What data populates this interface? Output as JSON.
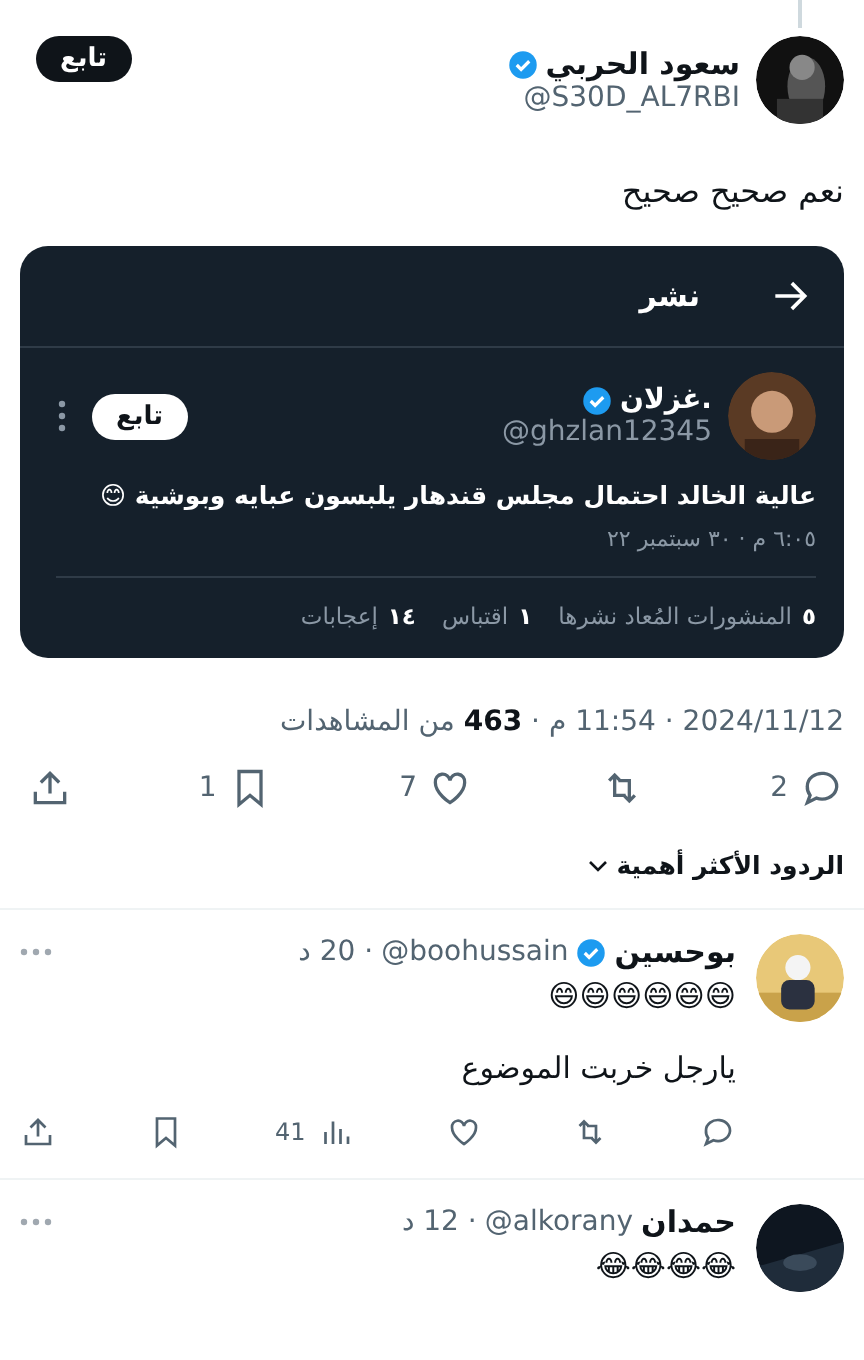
{
  "post": {
    "author": {
      "name": "سعود الحربي",
      "handle": "@S30D_AL7RBI",
      "verified": true
    },
    "follow_button": "تابع",
    "text": "نعم صحيح صحيح"
  },
  "quoted_card": {
    "title": "نشر",
    "author": {
      "name": ".غزلان",
      "handle": "@ghzlan12345",
      "verified": true
    },
    "follow_button": "تابع",
    "text": "عالية الخالد احتمال مجلس قندهار يلبسون عبايه وبوشية 😊",
    "timestamp": "٦:٠٥ م · ٣٠ سبتمبر ٢٢",
    "stats": [
      {
        "count": "٥",
        "label": "المنشورات المُعاد نشرها"
      },
      {
        "count": "١",
        "label": "اقتباس"
      },
      {
        "count": "١٤",
        "label": "إعجابات"
      }
    ]
  },
  "meta": "2024/11/12 · 11:54 م · **463** من المشاهدات",
  "actions": [
    {
      "kind": "reply",
      "count": "2"
    },
    {
      "kind": "repost"
    },
    {
      "kind": "like",
      "count": "7"
    },
    {
      "kind": "bookmark",
      "count": "1"
    },
    {
      "kind": "share"
    }
  ],
  "sort_label": "الردود الأكثر أهمية",
  "replies": [
    {
      "name": "بوحسين",
      "verified": true,
      "handle": "@boohussain",
      "time": "· 20 د",
      "lines": [
        "😄😄😄😄😄😄",
        "يارجل خربت الموضوع"
      ],
      "actions": [
        {
          "kind": "reply"
        },
        {
          "kind": "repost"
        },
        {
          "kind": "like"
        },
        {
          "kind": "views",
          "count": "41"
        },
        {
          "kind": "bookmark"
        },
        {
          "kind": "share"
        }
      ]
    },
    {
      "name": "حمدان",
      "verified": false,
      "handle": "@alkorany",
      "time": "· 12 د",
      "lines": [
        "😂😂😂😂"
      ]
    }
  ]
}
